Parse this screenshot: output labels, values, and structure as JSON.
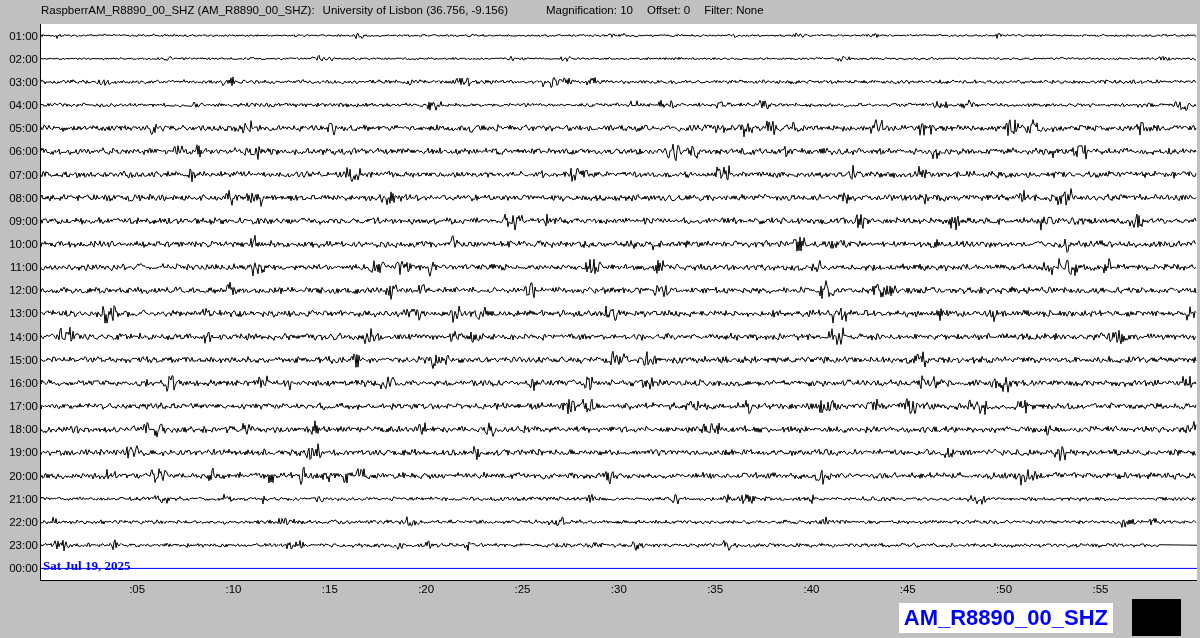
{
  "header": {
    "station": "RaspberrAM_R8890_00_SHZ (AM_R8890_00_SHZ):",
    "location": "University of Lisbon (36.756, -9.156)",
    "magnification": "Magnification: 10",
    "offset": "Offset: 0",
    "filter": "Filter: None"
  },
  "rows": [
    {
      "hour": "01:00",
      "kind": "recorded"
    },
    {
      "hour": "02:00",
      "kind": "recorded"
    },
    {
      "hour": "03:00",
      "kind": "recorded"
    },
    {
      "hour": "04:00",
      "kind": "recorded"
    },
    {
      "hour": "05:00",
      "kind": "recorded"
    },
    {
      "hour": "06:00",
      "kind": "recorded"
    },
    {
      "hour": "07:00",
      "kind": "recorded"
    },
    {
      "hour": "08:00",
      "kind": "recorded"
    },
    {
      "hour": "09:00",
      "kind": "recorded"
    },
    {
      "hour": "10:00",
      "kind": "recorded"
    },
    {
      "hour": "11:00",
      "kind": "recorded"
    },
    {
      "hour": "12:00",
      "kind": "recorded"
    },
    {
      "hour": "13:00",
      "kind": "recorded"
    },
    {
      "hour": "14:00",
      "kind": "recorded"
    },
    {
      "hour": "15:00",
      "kind": "recorded"
    },
    {
      "hour": "16:00",
      "kind": "recorded"
    },
    {
      "hour": "17:00",
      "kind": "recorded"
    },
    {
      "hour": "18:00",
      "kind": "recorded"
    },
    {
      "hour": "19:00",
      "kind": "recorded"
    },
    {
      "hour": "20:00",
      "kind": "recorded"
    },
    {
      "hour": "21:00",
      "kind": "recorded"
    },
    {
      "hour": "22:00",
      "kind": "recorded"
    },
    {
      "hour": "23:00",
      "kind": "partial"
    },
    {
      "hour": "00:00",
      "kind": "current"
    }
  ],
  "date_label": "Sat Jul 19, 2025",
  "minute_ticks": [
    ":05",
    ":10",
    ":15",
    ":20",
    ":25",
    ":30",
    ":35",
    ":40",
    ":45",
    ":50",
    ":55"
  ],
  "station_badge": "AM_R8890_00_SHZ"
}
